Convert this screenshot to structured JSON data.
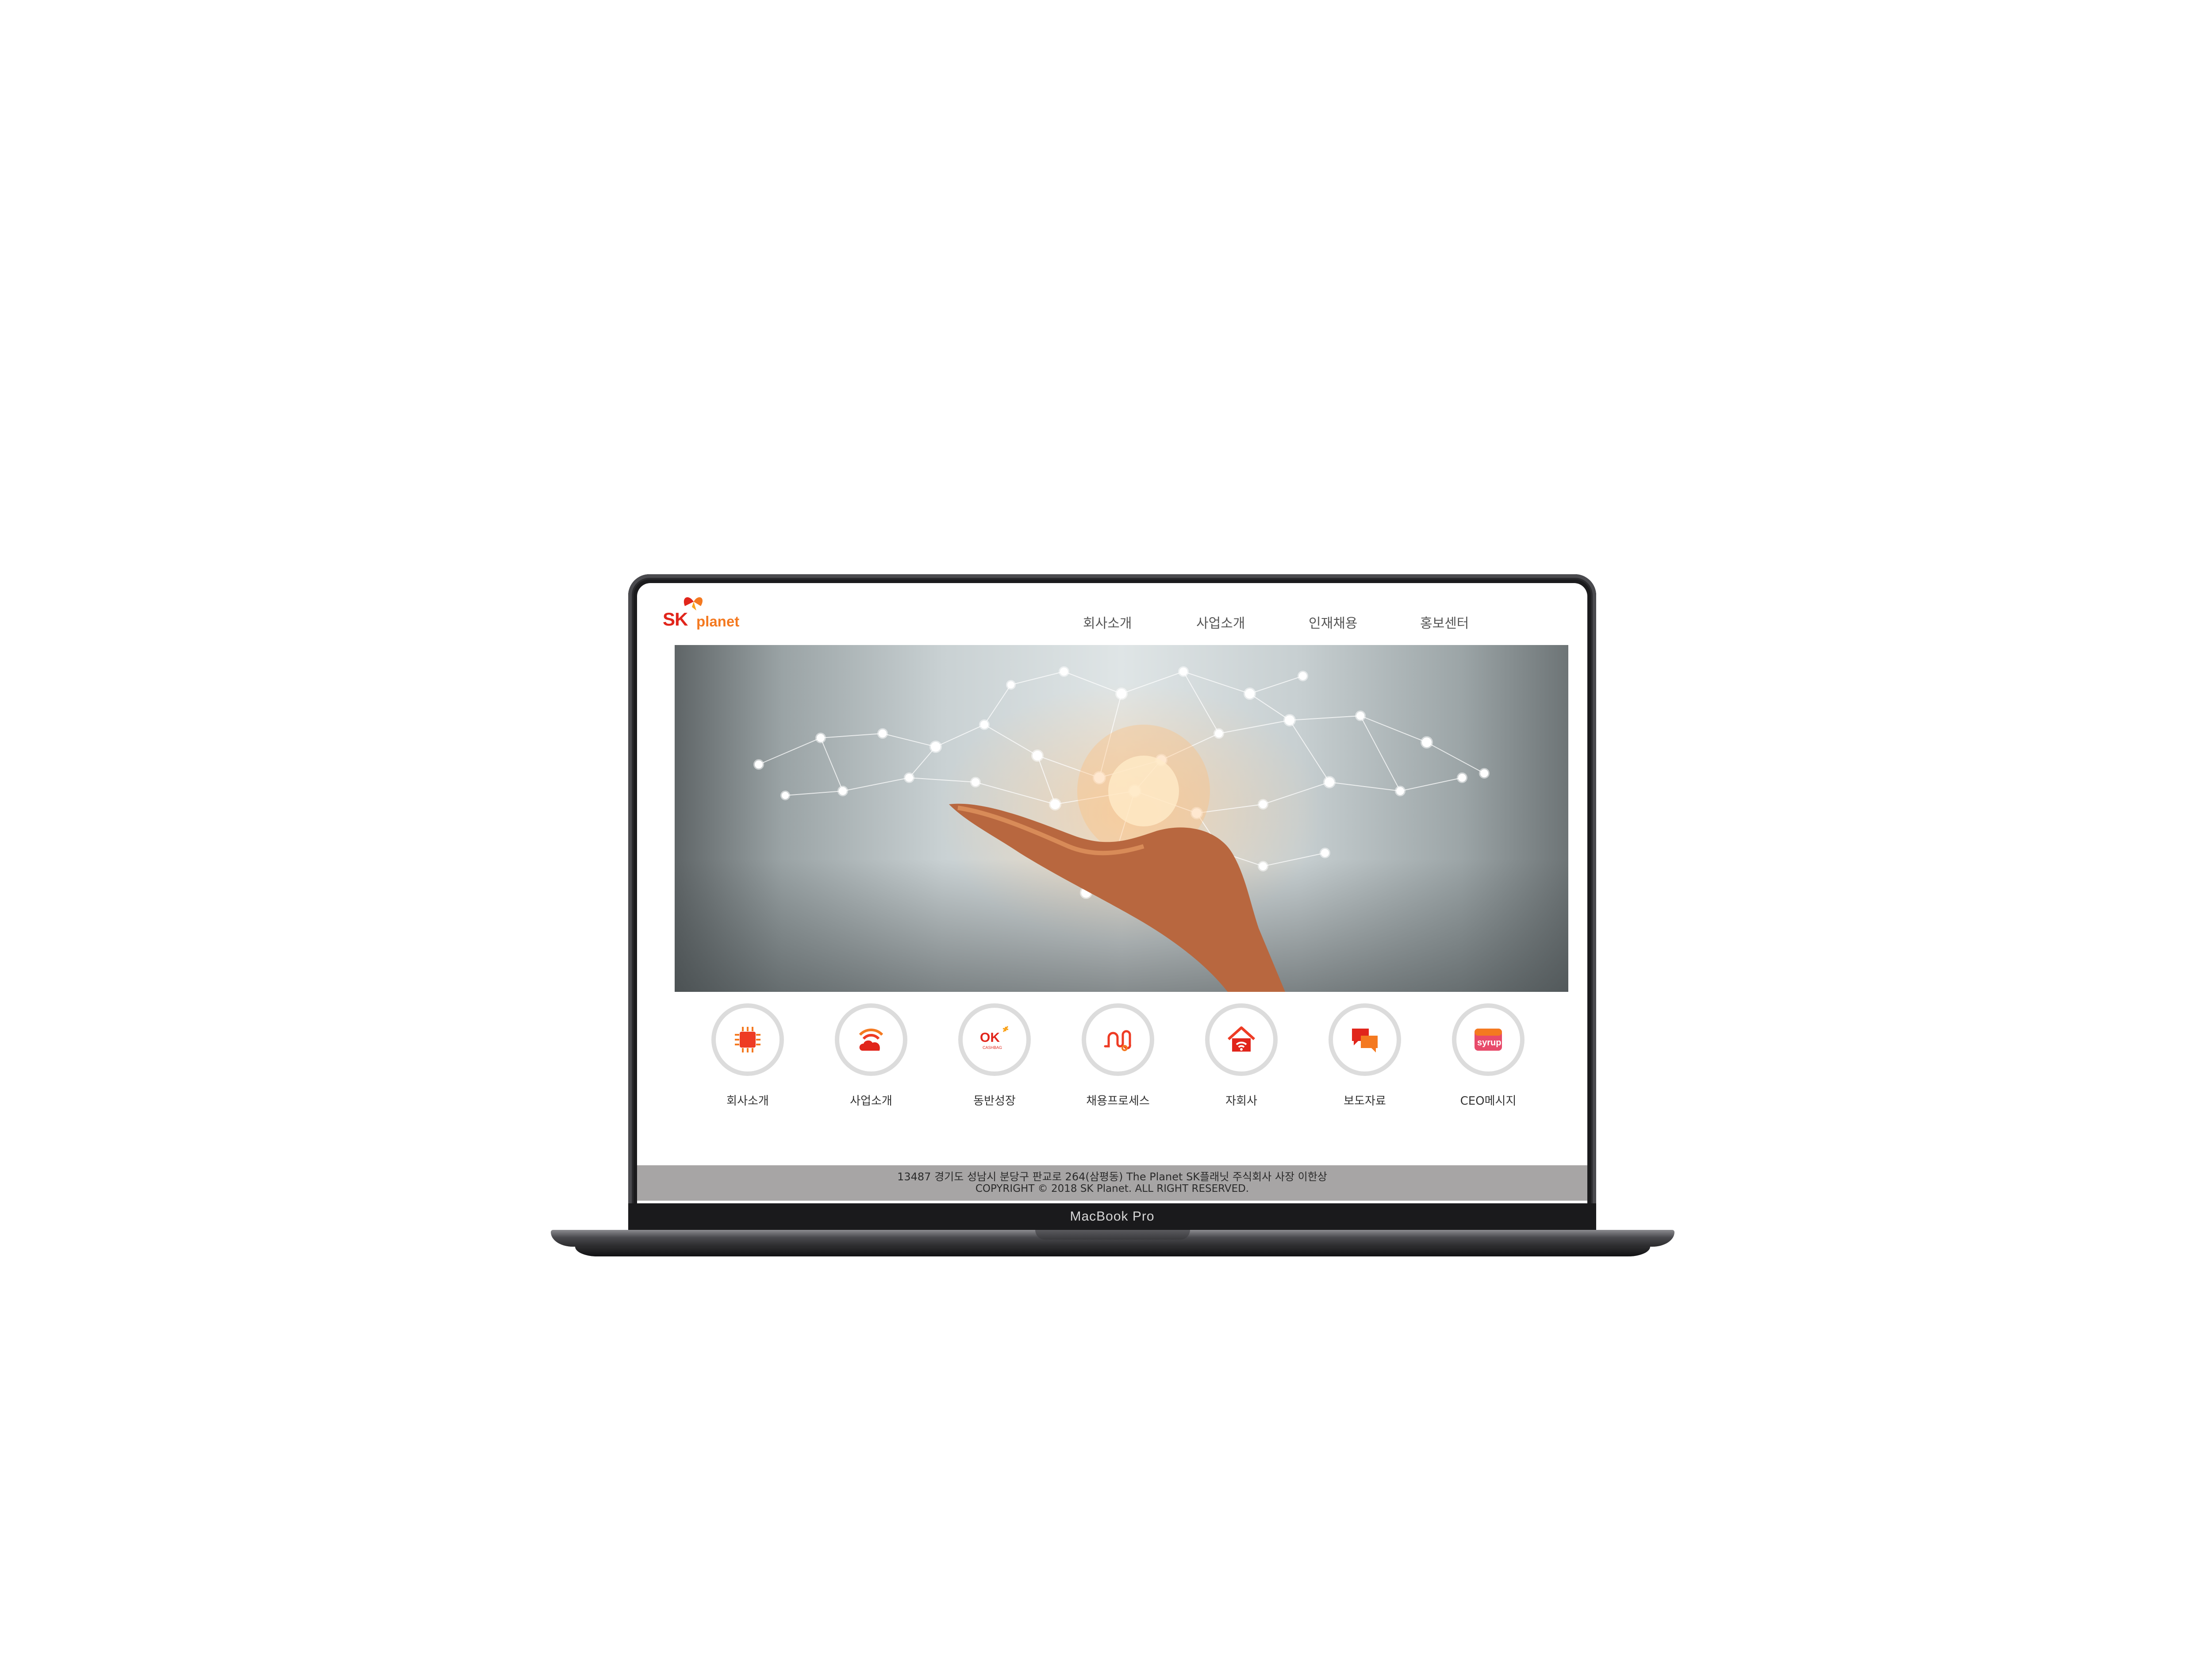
{
  "logo": {
    "brand": "SK",
    "name": "planet"
  },
  "nav": {
    "items": [
      "회사소개",
      "사업소개",
      "인재채용",
      "홍보센터"
    ]
  },
  "hero": {
    "description_icon": "hand-network-image"
  },
  "tiles": [
    {
      "label": "회사소개",
      "icon": "chip-icon"
    },
    {
      "label": "사업소개",
      "icon": "cloud-wifi-icon"
    },
    {
      "label": "동반성장",
      "icon": "ok-cashbag-icon",
      "badge": "OK",
      "badge_sub": "CASHBAG"
    },
    {
      "label": "채용프로세스",
      "icon": "flow-path-icon"
    },
    {
      "label": "자회사",
      "icon": "house-wifi-icon"
    },
    {
      "label": "보도자료",
      "icon": "chat-bubbles-icon"
    },
    {
      "label": "CEO메시지",
      "icon": "syrup-icon",
      "badge": "syrup"
    }
  ],
  "footer": {
    "address": "13487 경기도 성남시 분당구 판교로 264(삼평동) The Planet SK플래닛 주식회사 사장 이한상",
    "copyright": "COPYRIGHT © 2018 SK Planet. ALL RIGHT RESERVED."
  },
  "device": {
    "model": "MacBook Pro"
  },
  "colors": {
    "brand_red": "#e1251b",
    "brand_orange": "#f47920",
    "footer_bg": "#a7a5a5"
  }
}
